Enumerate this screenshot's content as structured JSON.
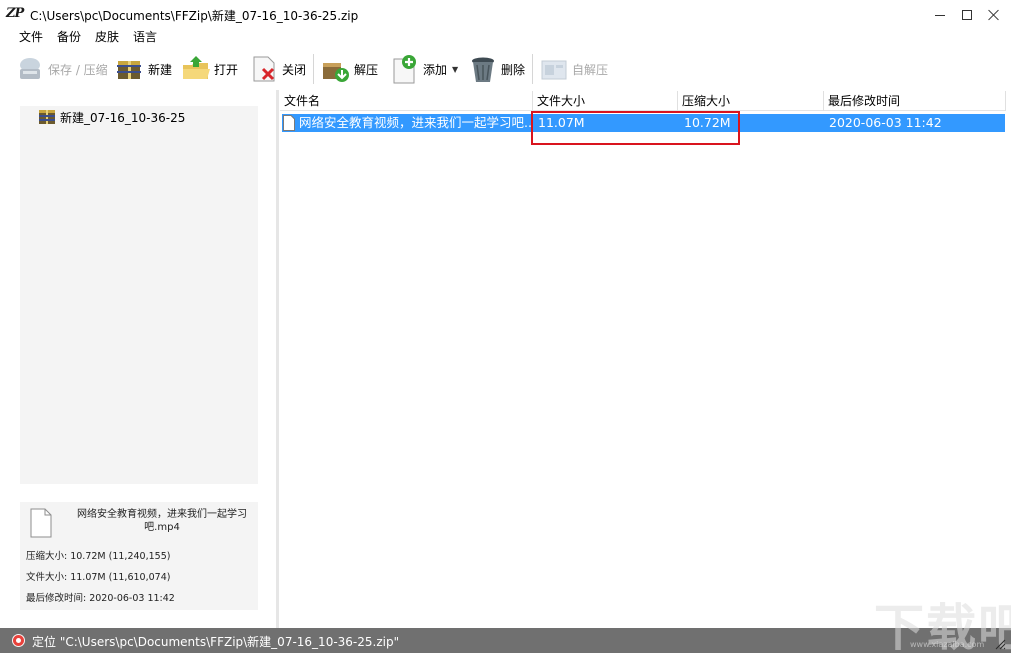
{
  "window": {
    "logo": "ZP",
    "title": "C:\\Users\\pc\\Documents\\FFZip\\新建_07-16_10-36-25.zip"
  },
  "menu": [
    "文件",
    "备份",
    "皮肤",
    "语言"
  ],
  "toolbar": {
    "save_compress": "保存 / 压缩",
    "new": "新建",
    "open": "打开",
    "close": "关闭",
    "extract": "解压",
    "add": "添加",
    "delete": "删除",
    "self_extract": "自解压"
  },
  "tree": {
    "root": "新建_07-16_10-36-25"
  },
  "file_list": {
    "columns": [
      "文件名",
      "文件大小",
      "压缩大小",
      "最后修改时间"
    ],
    "rows": [
      {
        "name": "网络安全教育视频，进来我们一起学习吧....",
        "size": "11.07M",
        "compressed": "10.72M",
        "modified": "2020-06-03 11:42"
      }
    ]
  },
  "info": {
    "filename": "网络安全教育视频，进来我们一起学习吧.mp4",
    "compressed_size": "压缩大小: 10.72M (11,240,155)",
    "file_size": "文件大小: 11.07M (11,610,074)",
    "modified": "最后修改时间: 2020-06-03 11:42"
  },
  "status": {
    "text": "定位 \"C:\\Users\\pc\\Documents\\FFZip\\新建_07-16_10-36-25.zip\""
  },
  "watermark": {
    "main": "下载吧",
    "sub": "www.xiazaiba.com"
  },
  "colors": {
    "selection": "#3399ff",
    "highlight": "#d9141e",
    "statusbar": "#707070"
  }
}
